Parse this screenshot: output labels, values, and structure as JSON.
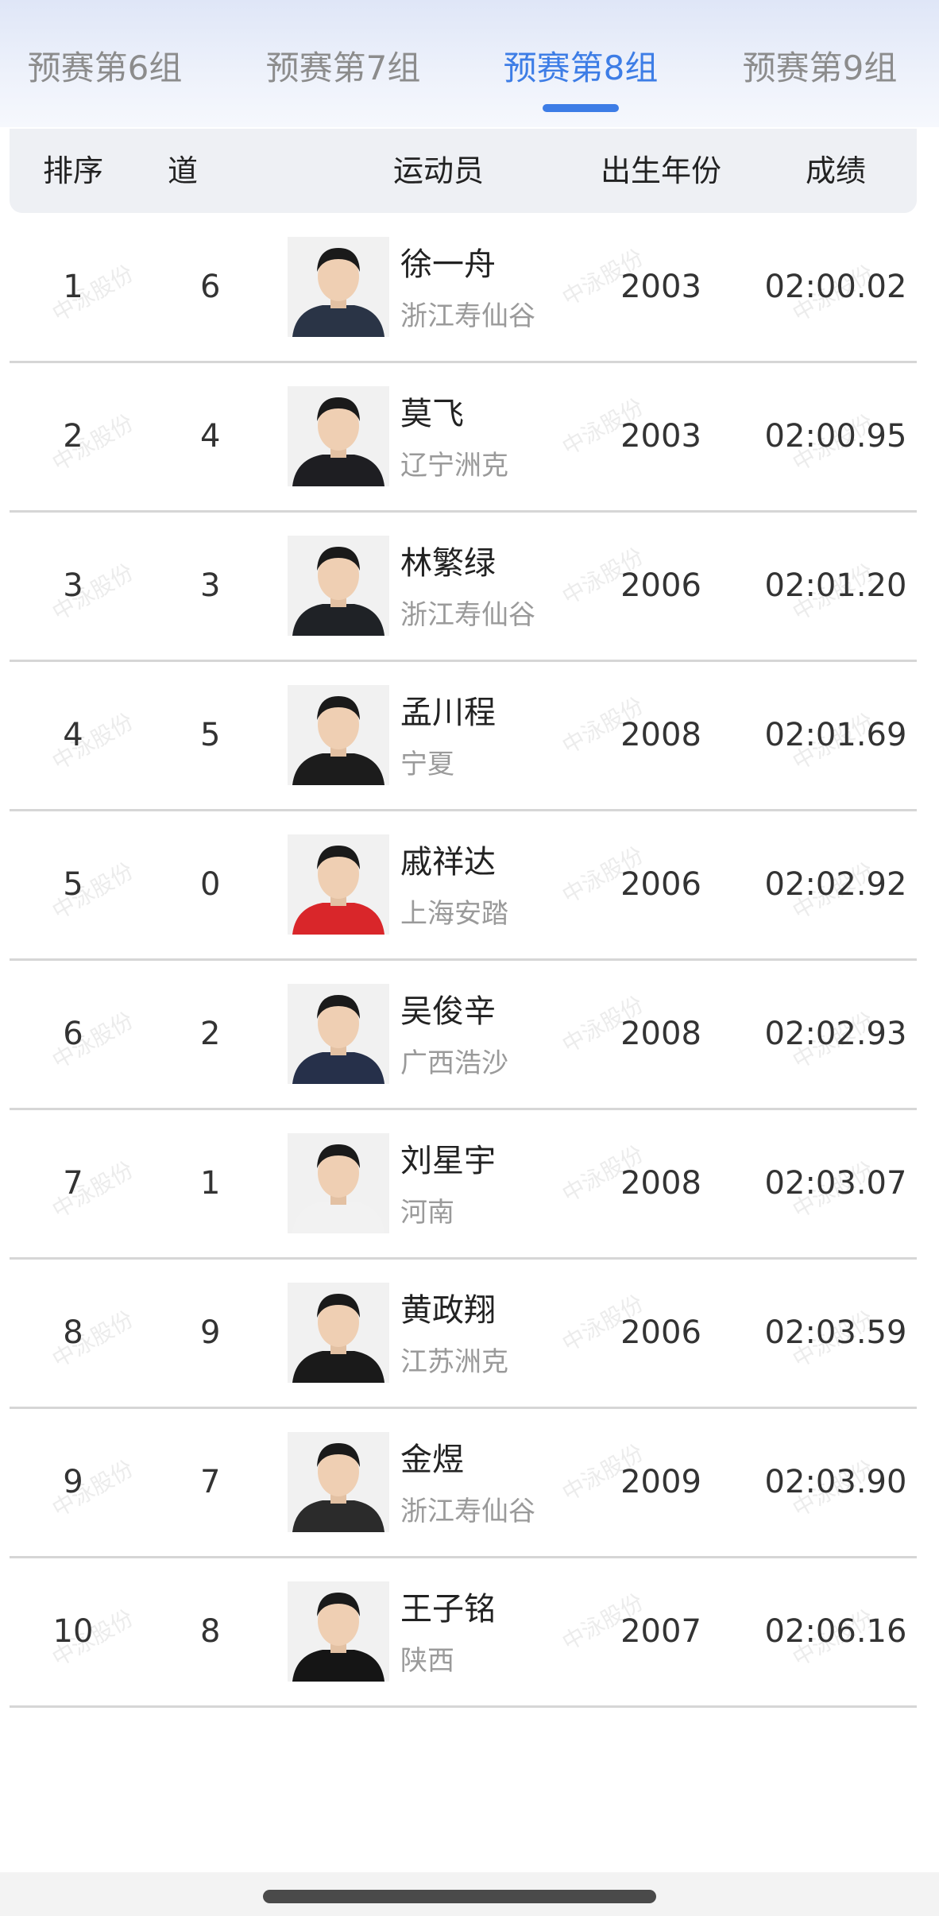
{
  "tabs": [
    {
      "label": "预赛第6组",
      "active": false
    },
    {
      "label": "预赛第7组",
      "active": false
    },
    {
      "label": "预赛第8组",
      "active": true
    },
    {
      "label": "预赛第9组",
      "active": false
    }
  ],
  "columns": {
    "rank": "排序",
    "lane": "道",
    "athlete": "运动员",
    "birth_year": "出生年份",
    "result": "成绩"
  },
  "watermark": "中泳股份",
  "rows": [
    {
      "rank": "1",
      "lane": "6",
      "name": "徐一舟",
      "team": "浙江寿仙谷",
      "birth_year": "2003",
      "result": "02:00.02",
      "shirt": "#2a3446"
    },
    {
      "rank": "2",
      "lane": "4",
      "name": "莫飞",
      "team": "辽宁洲克",
      "birth_year": "2003",
      "result": "02:00.95",
      "shirt": "#1e1e22"
    },
    {
      "rank": "3",
      "lane": "3",
      "name": "林繁绿",
      "team": "浙江寿仙谷",
      "birth_year": "2006",
      "result": "02:01.20",
      "shirt": "#1f2226"
    },
    {
      "rank": "4",
      "lane": "5",
      "name": "孟川程",
      "team": "宁夏",
      "birth_year": "2008",
      "result": "02:01.69",
      "shirt": "#1c1c1c"
    },
    {
      "rank": "5",
      "lane": "0",
      "name": "戚祥达",
      "team": "上海安踏",
      "birth_year": "2006",
      "result": "02:02.92",
      "shirt": "#d9262a"
    },
    {
      "rank": "6",
      "lane": "2",
      "name": "吴俊辛",
      "team": "广西浩沙",
      "birth_year": "2008",
      "result": "02:02.93",
      "shirt": "#26304a"
    },
    {
      "rank": "7",
      "lane": "1",
      "name": "刘星宇",
      "team": "河南",
      "birth_year": "2008",
      "result": "02:03.07",
      "shirt": "#f2f2f2"
    },
    {
      "rank": "8",
      "lane": "9",
      "name": "黄政翔",
      "team": "江苏洲克",
      "birth_year": "2006",
      "result": "02:03.59",
      "shirt": "#1a1a1a"
    },
    {
      "rank": "9",
      "lane": "7",
      "name": "金煜",
      "team": "浙江寿仙谷",
      "birth_year": "2009",
      "result": "02:03.90",
      "shirt": "#2b2b2b"
    },
    {
      "rank": "10",
      "lane": "8",
      "name": "王子铭",
      "team": "陕西",
      "birth_year": "2007",
      "result": "02:06.16",
      "shirt": "#151515"
    }
  ],
  "colors": {
    "accent": "#3d7de6",
    "tab_inactive": "#8c8c8c",
    "team_text": "#9a9a9a",
    "divider": "#d6d6d6"
  }
}
